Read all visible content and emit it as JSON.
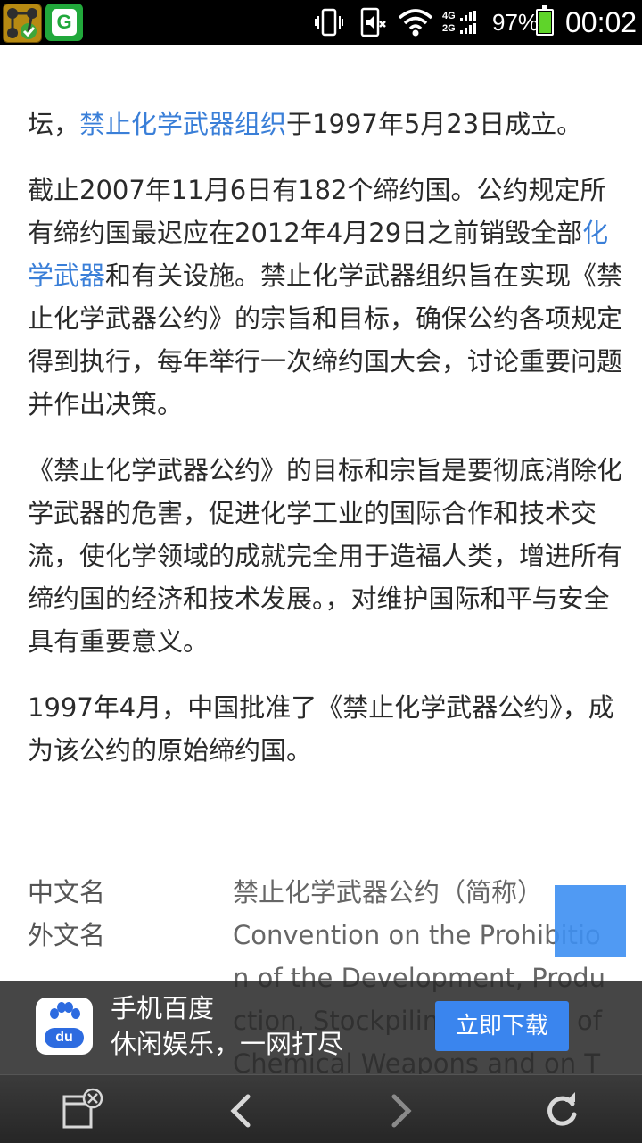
{
  "status_bar": {
    "network_type_top": "4G",
    "network_type_bottom": "2G",
    "battery_percent": "97%",
    "time": "00:02",
    "app_icon_b_letter": "G",
    "icons": [
      "app-icon-a",
      "app-icon-g",
      "vibrate-icon",
      "mute-icon",
      "wifi-icon",
      "signal-icon",
      "battery-icon"
    ]
  },
  "article": {
    "p1": {
      "prefix": "坛，",
      "link": "禁止化学武器组织",
      "suffix": "于1997年5月23日成立。"
    },
    "p2": {
      "part1": "截止2007年11月6日有182个缔约国。公约规定所有缔约国最迟应在2012年4月29日之前销毁全部",
      "link": "化学武器",
      "part2": "和有关设施。禁止化学武器组织旨在实现《禁止化学武器公约》的宗旨和目标，确保公约各项规定得到执行，每年举行一次缔约国大会，讨论重要问题并作出决策。"
    },
    "p3": "《禁止化学武器公约》的目标和宗旨是要彻底消除化学武器的危害，促进化学工业的国际合作和技术交流，使化学领域的成就完全用于造福人类，增进所有缔约国的经济和技术发展。，对维护国际和平与安全具有重要意义。",
    "p4": "1997年4月，中国批准了《禁止化学武器公约》，成为该公约的原始缔约国。"
  },
  "info_table": {
    "rows": [
      {
        "label": "中文名",
        "value": "禁止化学武器公约（简称）"
      },
      {
        "label": "外文名",
        "value": "Convention on the Prohibition of the Development, Production, Stockpiling and Use of Chemical Weapons and on Their"
      }
    ]
  },
  "ad": {
    "logo_text": "du",
    "title": "手机百度",
    "subtitle": "休闲娱乐，一网打尽",
    "button_label": "立即下载"
  },
  "bottom_toolbar": {
    "icons": [
      "close-tab-icon",
      "back-icon",
      "forward-icon",
      "refresh-icon"
    ]
  },
  "colors": {
    "header_blue": "#3d8ff2",
    "link_blue": "#3a7fd8",
    "ad_button": "#3a85ee",
    "battery_green": "#5fd42a"
  }
}
